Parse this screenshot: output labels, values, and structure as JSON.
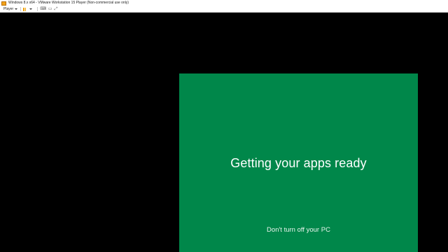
{
  "window": {
    "title": "Windows 8.x x64 - VMware Workstation 15 Player (Non-commercial use only)"
  },
  "toolbar": {
    "player_label": "Player",
    "icons": [
      "pause-icon",
      "dropdown-icon",
      "send-ctrl-alt-del-icon",
      "unity-icon",
      "fullscreen-icon"
    ]
  },
  "guest": {
    "background_color": "#00874a",
    "headline": "Getting your apps ready",
    "subline": "Don't turn off your PC"
  }
}
